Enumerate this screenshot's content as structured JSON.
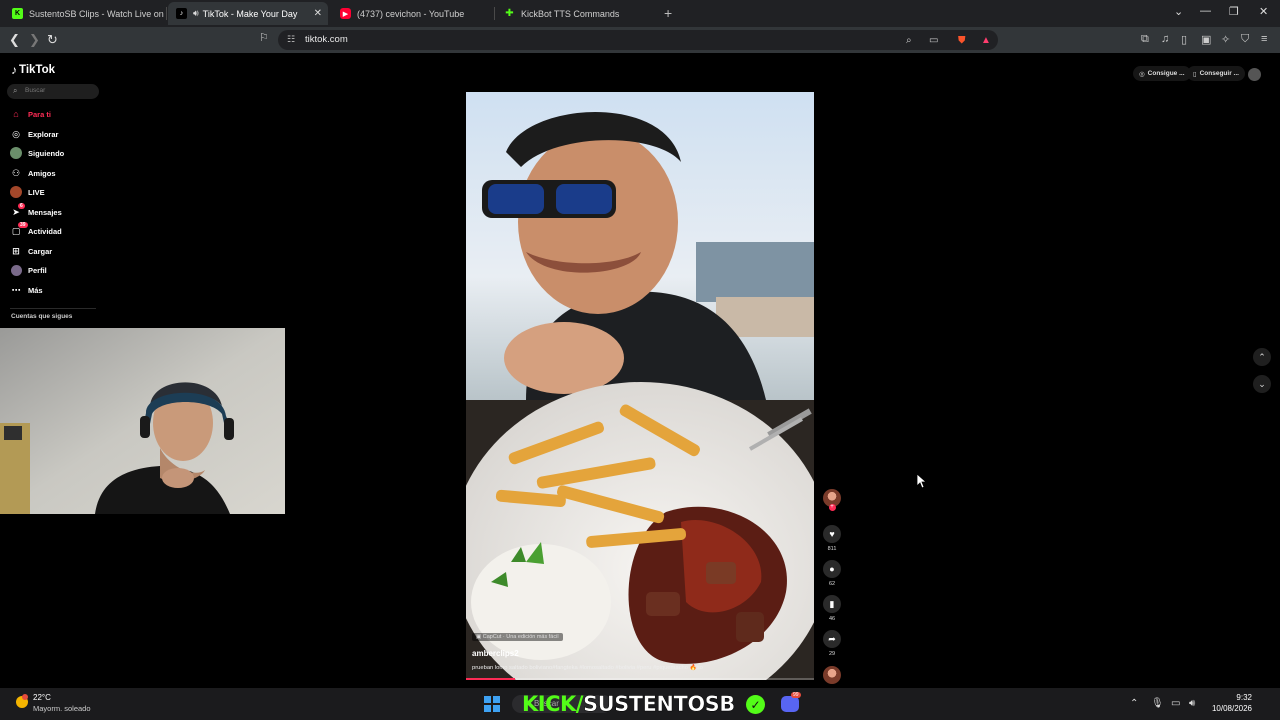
{
  "browser": {
    "tabs": [
      {
        "title": "SustentoSB Clips - Watch Live on",
        "favicon": "kick-icon",
        "color": "#53fc18",
        "active": false
      },
      {
        "title": "TikTok - Make Your Day",
        "favicon": "tiktok-icon",
        "color": "#ffffff",
        "active": true,
        "close": "✕"
      },
      {
        "title": "(4737) cevichon - YouTube",
        "favicon": "youtube-icon",
        "color": "#ff0033",
        "active": false
      },
      {
        "title": "KickBot TTS Commands",
        "favicon": "kickbot-icon",
        "color": "#53fc18",
        "active": false
      }
    ],
    "new_tab": "+",
    "url": "tiktok.com"
  },
  "tiktok": {
    "logo": "TikTok",
    "search_placeholder": "Buscar",
    "nav": [
      {
        "label": "Para ti",
        "icon": "home-icon",
        "active": true
      },
      {
        "label": "Explorar",
        "icon": "compass-icon"
      },
      {
        "label": "Siguiendo",
        "icon": "following-avatar-icon"
      },
      {
        "label": "Amigos",
        "icon": "friends-icon"
      },
      {
        "label": "LIVE",
        "icon": "live-icon"
      },
      {
        "label": "Mensajes",
        "icon": "messages-icon",
        "badge": "6"
      },
      {
        "label": "Actividad",
        "icon": "activity-icon",
        "badge": "39"
      },
      {
        "label": "Cargar",
        "icon": "upload-icon"
      },
      {
        "label": "Perfil",
        "icon": "profile-icon"
      },
      {
        "label": "Más",
        "icon": "more-icon"
      }
    ],
    "following_title": "Cuentas que sigues",
    "top_right": {
      "coins_label": "Consigue ...",
      "app_label": "Conseguir ..."
    },
    "video": {
      "capcut_tag": "CapCut · Una edición más fácil",
      "username": "amberclips2",
      "description": "prueban lomo saltado boliviano#fangteka #lomosaltado #bolivia #peru #piquemacho 🔥so",
      "progress": 0.14
    },
    "actions": {
      "likes": "811",
      "comments": "62",
      "saves": "46",
      "shares": "29"
    }
  },
  "taskbar": {
    "weather_temp": "22°C",
    "weather_desc": "Mayorm. soleado",
    "search_placeholder": "Buscar",
    "overlay_kick": "KICK/",
    "overlay_name": "SUSTENTOSB",
    "discord_badge": "99",
    "time": "9:32",
    "date": "10/08/2026"
  },
  "colors": {
    "tiktok_accent": "#fe2c55",
    "kick_green": "#53fc18"
  }
}
